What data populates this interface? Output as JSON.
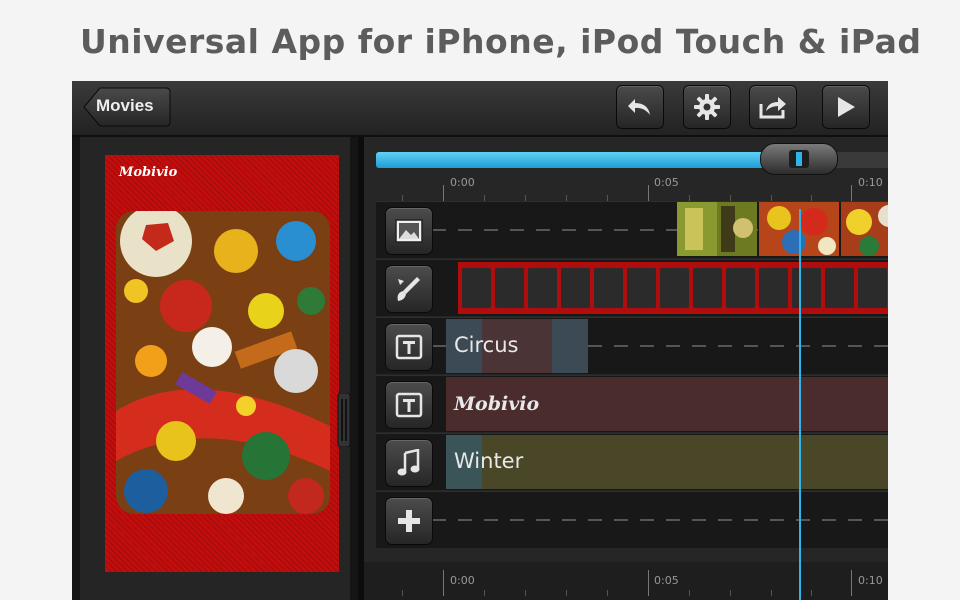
{
  "headline": "Universal App for iPhone, iPod Touch & iPad",
  "toolbar": {
    "back_label": "Movies",
    "buttons": [
      {
        "name": "undo",
        "icon": "undo-icon"
      },
      {
        "name": "settings",
        "icon": "gear-icon"
      },
      {
        "name": "share",
        "icon": "share-icon"
      },
      {
        "name": "play",
        "icon": "play-icon"
      }
    ]
  },
  "preview": {
    "poster_title": "Mobivio",
    "poster_color": "#c20d0d"
  },
  "timeline": {
    "scrubber_progress": 0.77,
    "ruler_labels": [
      "0:00",
      "0:05",
      "0:10"
    ],
    "tracks": [
      {
        "type": "photo",
        "icon": "image-icon"
      },
      {
        "type": "effect",
        "icon": "brush-icon"
      },
      {
        "type": "title",
        "icon": "text-icon",
        "clip_label": "Circus"
      },
      {
        "type": "title",
        "icon": "text-icon",
        "clip_label": "Mobivio"
      },
      {
        "type": "music",
        "icon": "music-note-icon",
        "clip_label": "Winter"
      },
      {
        "type": "add",
        "icon": "plus-icon"
      }
    ]
  },
  "colors": {
    "accent": "#2fb4ea",
    "film": "#b00d0d",
    "circus_clip": "#3b4a55",
    "mobivio_clip": "#4a2c2c",
    "winter_clip": "#4a4628"
  }
}
